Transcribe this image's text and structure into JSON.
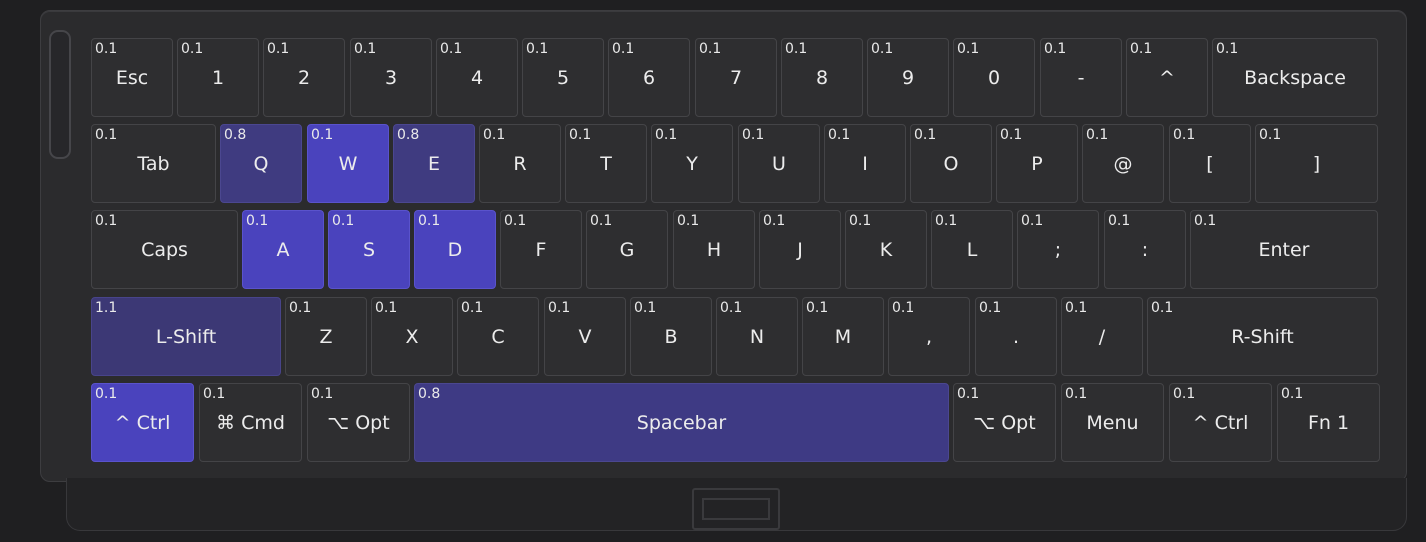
{
  "keyboard": {
    "rows": [
      [
        {
          "label": "Esc",
          "weight": "0.1"
        },
        {
          "label": "1",
          "weight": "0.1"
        },
        {
          "label": "2",
          "weight": "0.1"
        },
        {
          "label": "3",
          "weight": "0.1"
        },
        {
          "label": "4",
          "weight": "0.1"
        },
        {
          "label": "5",
          "weight": "0.1"
        },
        {
          "label": "6",
          "weight": "0.1"
        },
        {
          "label": "7",
          "weight": "0.1"
        },
        {
          "label": "8",
          "weight": "0.1"
        },
        {
          "label": "9",
          "weight": "0.1"
        },
        {
          "label": "0",
          "weight": "0.1"
        },
        {
          "label": "-",
          "weight": "0.1"
        },
        {
          "label": "^",
          "weight": "0.1"
        },
        {
          "label": "Backspace",
          "weight": "0.1"
        }
      ],
      [
        {
          "label": "Tab",
          "weight": "0.1"
        },
        {
          "label": "Q",
          "weight": "0.8"
        },
        {
          "label": "W",
          "weight": "0.1",
          "active": true
        },
        {
          "label": "E",
          "weight": "0.8"
        },
        {
          "label": "R",
          "weight": "0.1"
        },
        {
          "label": "T",
          "weight": "0.1"
        },
        {
          "label": "Y",
          "weight": "0.1"
        },
        {
          "label": "U",
          "weight": "0.1"
        },
        {
          "label": "I",
          "weight": "0.1"
        },
        {
          "label": "O",
          "weight": "0.1"
        },
        {
          "label": "P",
          "weight": "0.1"
        },
        {
          "label": "@",
          "weight": "0.1"
        },
        {
          "label": "[",
          "weight": "0.1"
        },
        {
          "label": "]",
          "weight": "0.1"
        }
      ],
      [
        {
          "label": "Caps",
          "weight": "0.1"
        },
        {
          "label": "A",
          "weight": "0.1",
          "active": true
        },
        {
          "label": "S",
          "weight": "0.1",
          "active": true
        },
        {
          "label": "D",
          "weight": "0.1",
          "active": true
        },
        {
          "label": "F",
          "weight": "0.1"
        },
        {
          "label": "G",
          "weight": "0.1"
        },
        {
          "label": "H",
          "weight": "0.1"
        },
        {
          "label": "J",
          "weight": "0.1"
        },
        {
          "label": "K",
          "weight": "0.1"
        },
        {
          "label": "L",
          "weight": "0.1"
        },
        {
          "label": ";",
          "weight": "0.1"
        },
        {
          "label": ":",
          "weight": "0.1"
        },
        {
          "label": "Enter",
          "weight": "0.1"
        }
      ],
      [
        {
          "label": "L-Shift",
          "weight": "1.1"
        },
        {
          "label": "Z",
          "weight": "0.1"
        },
        {
          "label": "X",
          "weight": "0.1"
        },
        {
          "label": "C",
          "weight": "0.1"
        },
        {
          "label": "V",
          "weight": "0.1"
        },
        {
          "label": "B",
          "weight": "0.1"
        },
        {
          "label": "N",
          "weight": "0.1"
        },
        {
          "label": "M",
          "weight": "0.1"
        },
        {
          "label": ",",
          "weight": "0.1"
        },
        {
          "label": ".",
          "weight": "0.1"
        },
        {
          "label": "/",
          "weight": "0.1"
        },
        {
          "label": "R-Shift",
          "weight": "0.1"
        }
      ],
      [
        {
          "label": "^ Ctrl",
          "weight": "0.1",
          "active": true
        },
        {
          "label": "⌘ Cmd",
          "weight": "0.1"
        },
        {
          "label": "⌥ Opt",
          "weight": "0.1"
        },
        {
          "label": "Spacebar",
          "weight": "0.8"
        },
        {
          "label": "⌥ Opt",
          "weight": "0.1"
        },
        {
          "label": "Menu",
          "weight": "0.1"
        },
        {
          "label": "^ Ctrl",
          "weight": "0.1"
        },
        {
          "label": "Fn 1",
          "weight": "0.1"
        }
      ]
    ]
  }
}
